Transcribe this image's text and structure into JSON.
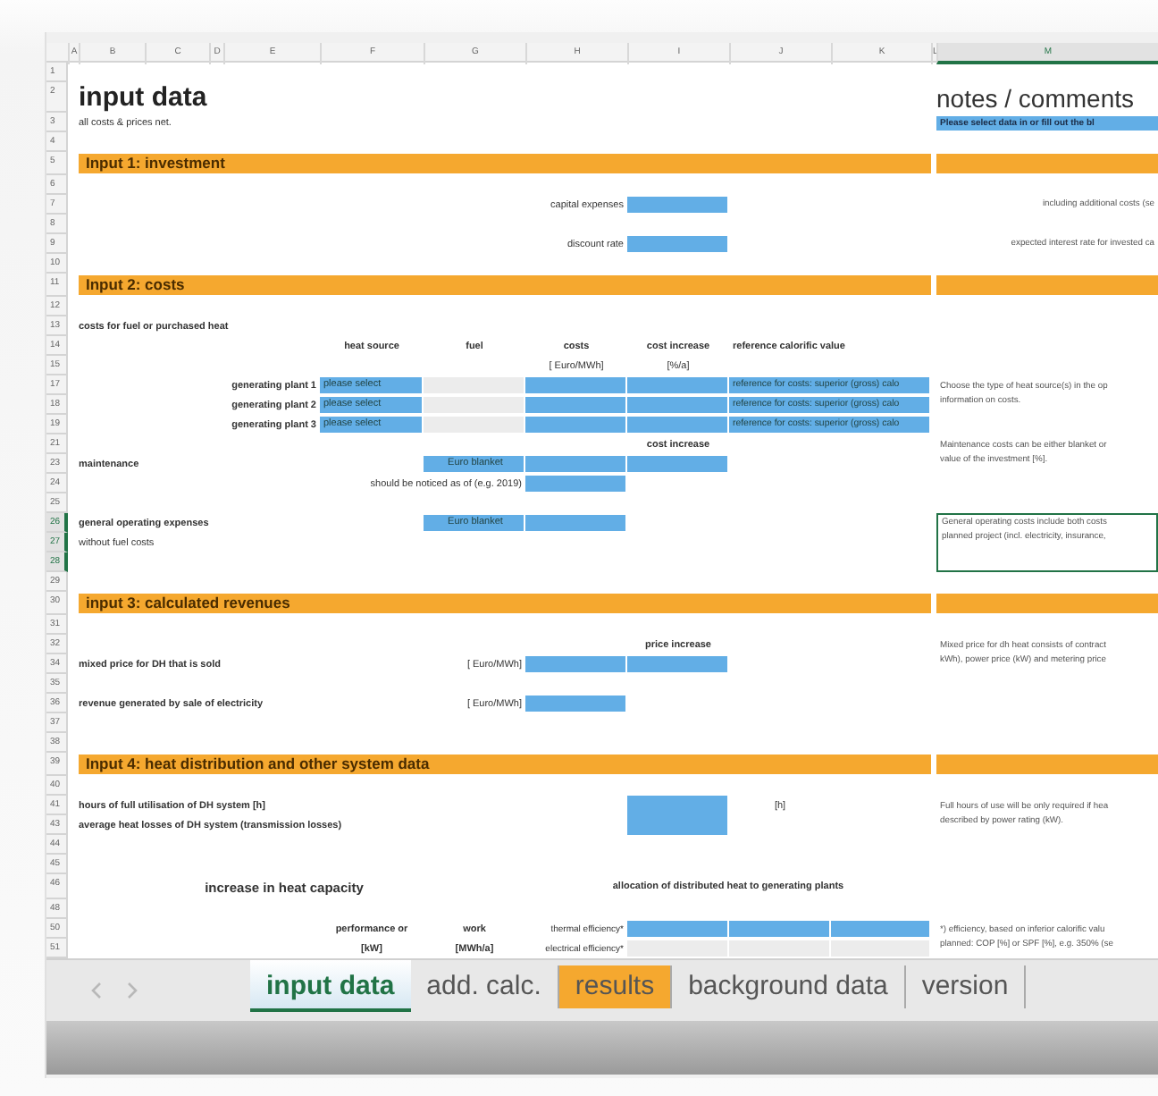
{
  "column_headers": [
    {
      "label": "A",
      "selected": false
    },
    {
      "label": "B",
      "selected": false
    },
    {
      "label": "C",
      "selected": false
    },
    {
      "label": "D",
      "selected": false
    },
    {
      "label": "E",
      "selected": false
    },
    {
      "label": "F",
      "selected": false
    },
    {
      "label": "G",
      "selected": false
    },
    {
      "label": "H",
      "selected": false
    },
    {
      "label": "I",
      "selected": false
    },
    {
      "label": "J",
      "selected": false
    },
    {
      "label": "K",
      "selected": false
    },
    {
      "label": "L",
      "selected": false
    },
    {
      "label": "M",
      "selected": true
    }
  ],
  "row_headers": [
    {
      "label": "1",
      "selected": false
    },
    {
      "label": "2",
      "selected": false
    },
    {
      "label": "3",
      "selected": false
    },
    {
      "label": "4",
      "selected": false
    },
    {
      "label": "5",
      "selected": false
    },
    {
      "label": "6",
      "selected": false
    },
    {
      "label": "7",
      "selected": false
    },
    {
      "label": "8",
      "selected": false
    },
    {
      "label": "9",
      "selected": false
    },
    {
      "label": "10",
      "selected": false
    },
    {
      "label": "11",
      "selected": false
    },
    {
      "label": "12",
      "selected": false
    },
    {
      "label": "13",
      "selected": false
    },
    {
      "label": "14",
      "selected": false
    },
    {
      "label": "15",
      "selected": false
    },
    {
      "label": "17",
      "selected": false
    },
    {
      "label": "18",
      "selected": false
    },
    {
      "label": "19",
      "selected": false
    },
    {
      "label": "21",
      "selected": false
    },
    {
      "label": "23",
      "selected": false
    },
    {
      "label": "24",
      "selected": false
    },
    {
      "label": "25",
      "selected": false
    },
    {
      "label": "26",
      "selected": true
    },
    {
      "label": "27",
      "selected": true
    },
    {
      "label": "28",
      "selected": true
    },
    {
      "label": "29",
      "selected": false
    },
    {
      "label": "30",
      "selected": false
    },
    {
      "label": "31",
      "selected": false
    },
    {
      "label": "32",
      "selected": false
    },
    {
      "label": "34",
      "selected": false
    },
    {
      "label": "35",
      "selected": false
    },
    {
      "label": "36",
      "selected": false
    },
    {
      "label": "37",
      "selected": false
    },
    {
      "label": "38",
      "selected": false
    },
    {
      "label": "39",
      "selected": false
    },
    {
      "label": "40",
      "selected": false
    },
    {
      "label": "41",
      "selected": false
    },
    {
      "label": "43",
      "selected": false
    },
    {
      "label": "44",
      "selected": false
    },
    {
      "label": "45",
      "selected": false
    },
    {
      "label": "46",
      "selected": false
    },
    {
      "label": "48",
      "selected": false
    },
    {
      "label": "50",
      "selected": false
    },
    {
      "label": "51",
      "selected": false
    }
  ],
  "title": "input data",
  "subtitle": "all costs & prices net.",
  "notes_title": "notes / comments",
  "notes_hint": "Please select data in or fill out the bl",
  "sections": [
    {
      "title": "Input 1: investment"
    },
    {
      "title": "Input 2: costs"
    },
    {
      "title": "input 3: calculated revenues"
    },
    {
      "title": "Input 4: heat distribution and other system data"
    }
  ],
  "investment": [
    {
      "label": "capital expenses",
      "note": "including additional costs (se"
    },
    {
      "label": "discount rate",
      "note": "expected interest rate for invested ca"
    }
  ],
  "costs": {
    "heading": "costs for fuel or purchased heat",
    "columns": [
      "heat source",
      "fuel",
      "costs",
      "cost increase",
      "reference calorific value"
    ],
    "units": [
      "[ Euro/MWh]",
      "[%/a]"
    ],
    "plants": [
      {
        "label": "generating plant 1",
        "heat_source": "please select",
        "reference": "reference for costs: superior (gross) calo"
      },
      {
        "label": "generating plant 2",
        "heat_source": "please select",
        "reference": "reference for costs: superior (gross) calo"
      },
      {
        "label": "generating plant 3",
        "heat_source": "please select",
        "reference": "reference for costs: superior (gross) calo"
      }
    ],
    "note_lines": [
      "Choose the type of heat source(s) in the op",
      "information on costs."
    ]
  },
  "maintenance": {
    "label": "maintenance",
    "unit_button": "Euro blanket",
    "increase_header": "cost increase",
    "date_hint": "should be noticed as of (e.g. 2019)",
    "note_lines": [
      "Maintenance costs can be either blanket or",
      "value of the investment [%]."
    ]
  },
  "operating": {
    "label": "general operating expenses",
    "sublabel": "without fuel costs",
    "unit_button": "Euro blanket",
    "selected": true,
    "note_lines": [
      "General operating costs include both costs",
      "planned project (incl. electricity, insurance,"
    ]
  },
  "revenues": {
    "increase_header": "price increase",
    "items": [
      {
        "label": "mixed price for DH that is sold",
        "unit": "[ Euro/MWh]",
        "has_increase": true
      },
      {
        "label": "revenue generated by sale of electricity",
        "unit": "[ Euro/MWh]",
        "has_increase": false
      }
    ],
    "note_lines": [
      "Mixed price for dh heat consists of contract",
      "kWh), power price (kW) and metering price"
    ]
  },
  "distribution": {
    "items": [
      {
        "label": "hours of full utilisation of DH system [h]",
        "unit": "[h]"
      },
      {
        "label": "average heat losses of DH system (transmission losses)"
      }
    ],
    "note_lines": [
      "Full hours of use will be only required if hea",
      "described by power rating (kW)."
    ],
    "capacity_title": "increase in heat capacity",
    "allocation_title": "allocation of distributed heat to generating plants",
    "capacity_columns": [
      {
        "title": "performance or",
        "unit": "[kW]"
      },
      {
        "title": "work",
        "unit": "[MWh/a]"
      }
    ],
    "efficiencies": [
      {
        "label": "thermal efficiency*",
        "editable": true
      },
      {
        "label": "electrical efficiency*",
        "editable": false
      }
    ],
    "efficiency_note_lines": [
      "*) efficiency, based on inferior calorific valu",
      "planned: COP [%] or SPF [%], e.g. 350% (se"
    ]
  },
  "sheet_tabs": [
    {
      "label": "input data",
      "selected": true
    },
    {
      "label": "add. calc.",
      "selected": false
    },
    {
      "label": "results",
      "selected": false,
      "color": "#f5a82f"
    },
    {
      "label": "background data",
      "selected": false
    },
    {
      "label": "version",
      "selected": false
    }
  ]
}
